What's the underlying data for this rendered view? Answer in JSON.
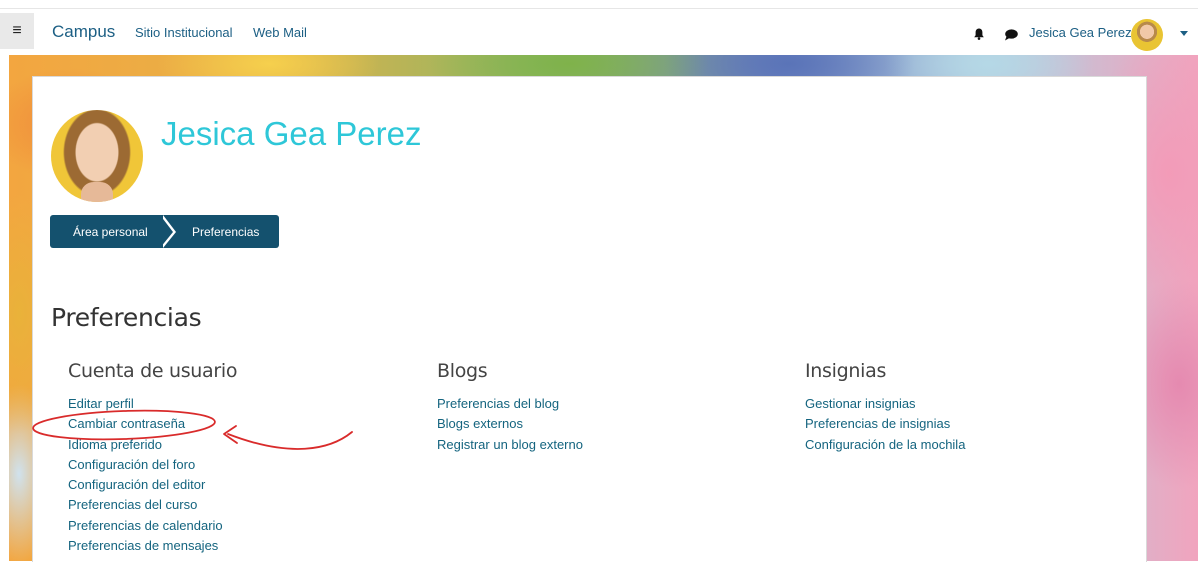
{
  "navbar": {
    "brand": "Campus",
    "links": [
      "Sitio Institucional",
      "Web Mail"
    ],
    "user_name": "Jesica Gea Perez"
  },
  "profile": {
    "name": "Jesica Gea Perez"
  },
  "breadcrumb": [
    "Área personal",
    "Preferencias"
  ],
  "page_title": "Preferencias",
  "sections": [
    {
      "title": "Cuenta de usuario",
      "links": [
        "Editar perfil",
        "Cambiar contraseña",
        "Idioma preferido",
        "Configuración del foro",
        "Configuración del editor",
        "Preferencias del curso",
        "Preferencias de calendario",
        "Preferencias de mensajes"
      ]
    },
    {
      "title": "Blogs",
      "links": [
        "Preferencias del blog",
        "Blogs externos",
        "Registrar un blog externo"
      ]
    },
    {
      "title": "Insignias",
      "links": [
        "Gestionar insignias",
        "Preferencias de insignias",
        "Configuración de la mochila"
      ]
    }
  ],
  "icons": {
    "menu": "hamburger-menu-icon",
    "notifications": "bell-icon",
    "messages": "chat-bubble-icon",
    "user_menu": "caret-down-icon"
  },
  "colors": {
    "brand": "#1c5f84",
    "breadcrumb_bg": "#14516e",
    "profile_name": "#2ec7d8",
    "link": "#14647f",
    "annotation": "#d92b2b"
  }
}
